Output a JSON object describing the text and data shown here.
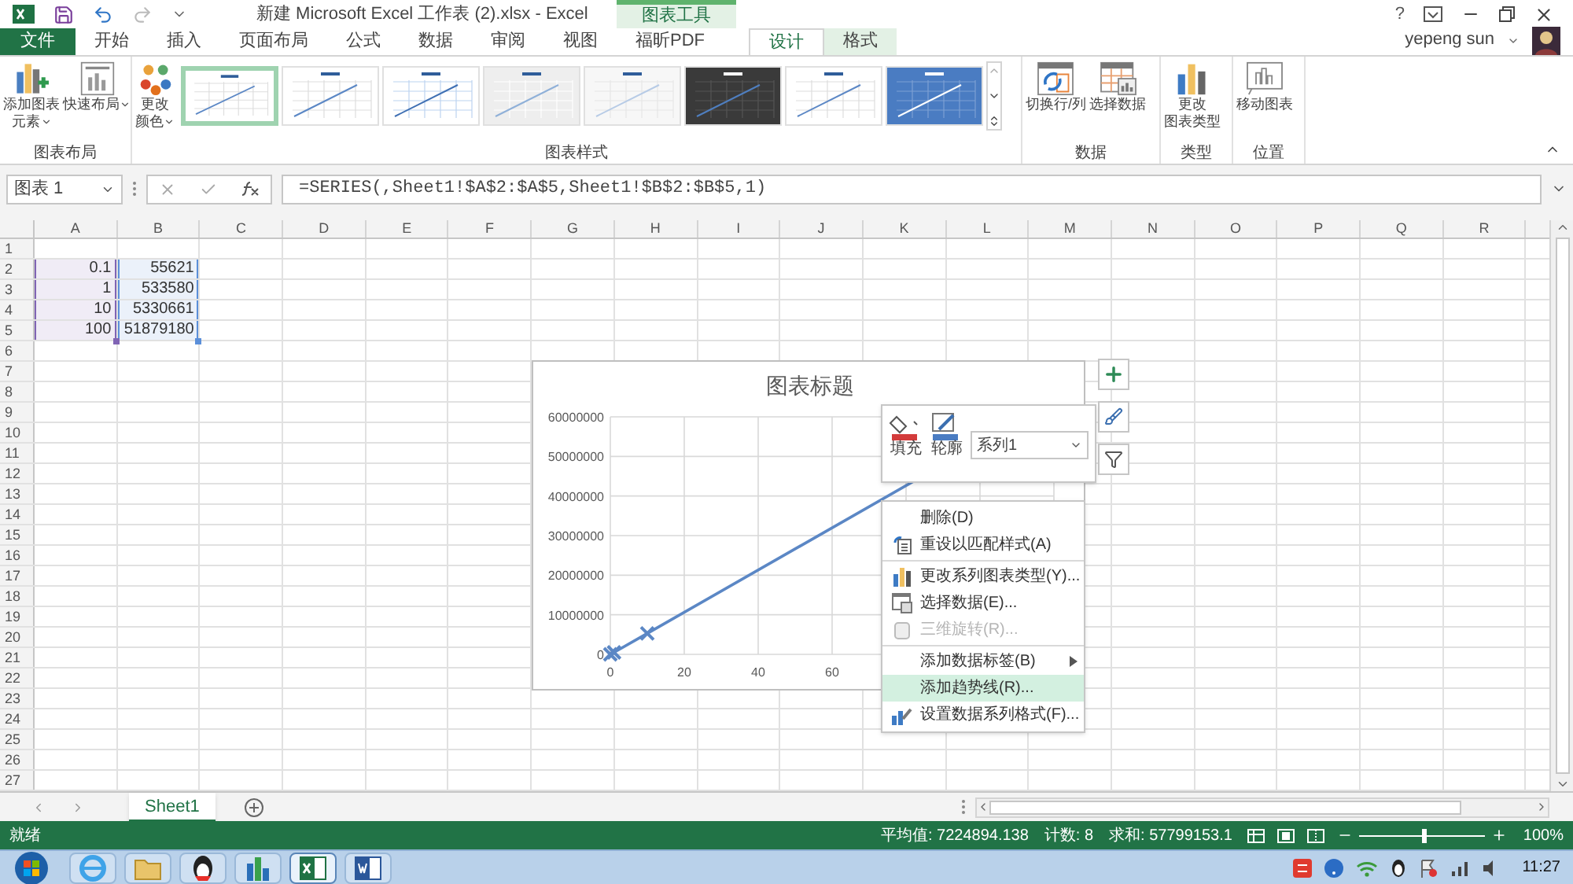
{
  "window": {
    "title": "新建 Microsoft Excel 工作表 (2).xlsx - Excel",
    "help": "?",
    "context_group": "图表工具",
    "user": "yepeng sun"
  },
  "tabs": [
    {
      "label": "文件",
      "kind": "file",
      "selected": false
    },
    {
      "label": "开始",
      "kind": "normal",
      "selected": false
    },
    {
      "label": "插入",
      "kind": "normal",
      "selected": false
    },
    {
      "label": "页面布局",
      "kind": "normal",
      "selected": false
    },
    {
      "label": "公式",
      "kind": "normal",
      "selected": false
    },
    {
      "label": "数据",
      "kind": "normal",
      "selected": false
    },
    {
      "label": "审阅",
      "kind": "normal",
      "selected": false
    },
    {
      "label": "视图",
      "kind": "normal",
      "selected": false
    },
    {
      "label": "福昕PDF",
      "kind": "normal",
      "selected": false
    },
    {
      "label": "设计",
      "kind": "context",
      "selected": true
    },
    {
      "label": "格式",
      "kind": "context",
      "selected": false
    }
  ],
  "ribbon": {
    "groups": [
      {
        "label": "图表布局",
        "buttons": [
          {
            "lines": [
              "添加图表",
              "元素"
            ],
            "dropdown": true
          },
          {
            "lines": [
              "快速布局"
            ],
            "dropdown": true
          }
        ]
      },
      {
        "label": "图表样式",
        "buttons": [
          {
            "lines": [
              "更改",
              "颜色"
            ],
            "dropdown": true
          }
        ],
        "styles": [
          {
            "selected": true
          },
          {
            "selected": false
          },
          {
            "selected": false
          },
          {
            "selected": false
          },
          {
            "selected": false
          },
          {
            "selected": false
          },
          {
            "selected": false
          },
          {
            "selected": false
          }
        ]
      },
      {
        "label": "数据",
        "buttons": [
          {
            "lines": [
              "切换行/列"
            ],
            "dropdown": false
          },
          {
            "lines": [
              "选择数据"
            ],
            "dropdown": false
          }
        ]
      },
      {
        "label": "类型",
        "buttons": [
          {
            "lines": [
              "更改",
              "图表类型"
            ],
            "dropdown": false
          }
        ]
      },
      {
        "label": "位置",
        "buttons": [
          {
            "lines": [
              "移动图表"
            ],
            "dropdown": false
          }
        ]
      }
    ]
  },
  "formula_bar": {
    "name_box": "图表 1",
    "formula": "=SERIES(,Sheet1!$A$2:$A$5,Sheet1!$B$2:$B$5,1)"
  },
  "sheet": {
    "columns": [
      "A",
      "B",
      "C",
      "D",
      "E",
      "F",
      "G",
      "H",
      "I",
      "J",
      "K",
      "L",
      "M",
      "N",
      "O",
      "P",
      "Q",
      "R"
    ],
    "ranges": [
      {
        "color": "#8064b4"
      },
      {
        "color": "#5b8fd9"
      }
    ],
    "rows": [
      {
        "number": "1"
      },
      {
        "number": "2",
        "cells": [
          "0.1",
          "55621"
        ]
      },
      {
        "number": "3",
        "cells": [
          "1",
          "533580"
        ]
      },
      {
        "number": "4",
        "cells": [
          "10",
          "5330661"
        ]
      },
      {
        "number": "5",
        "cells": [
          "100",
          "51879180"
        ]
      },
      {
        "number": "6"
      },
      {
        "number": "7"
      },
      {
        "number": "8"
      },
      {
        "number": "9"
      },
      {
        "number": "10"
      },
      {
        "number": "11"
      },
      {
        "number": "12"
      },
      {
        "number": "13"
      },
      {
        "number": "14"
      },
      {
        "number": "15"
      },
      {
        "number": "16"
      },
      {
        "number": "17"
      },
      {
        "number": "18"
      },
      {
        "number": "19"
      },
      {
        "number": "20"
      },
      {
        "number": "21"
      },
      {
        "number": "22"
      },
      {
        "number": "23"
      },
      {
        "number": "24"
      },
      {
        "number": "25"
      },
      {
        "number": "26"
      },
      {
        "number": "27"
      }
    ]
  },
  "chart": {
    "chart_data": {
      "type": "scatter",
      "title": "图表标题",
      "x": [
        0,
        1,
        10
      ],
      "grid": true,
      "series": [
        {
          "color": "#5b87c5",
          "values": [
            0,
            500000,
            5300000
          ]
        }
      ],
      "xlim": [
        0,
        120
      ],
      "ylim": [
        0,
        60000000
      ],
      "xticks": [
        0,
        20,
        40,
        60
      ],
      "yticks": [
        0,
        10000000,
        20000000,
        30000000,
        40000000,
        50000000,
        60000000
      ]
    }
  },
  "mini_toolbar": {
    "fill": "填充",
    "outline": "轮廓",
    "series": "系列1"
  },
  "context_menu": [
    {
      "label": "删除(D)",
      "disabled": false,
      "highlighted": false,
      "submenu": false,
      "separator_before": false
    },
    {
      "label": "重设以匹配样式(A)",
      "disabled": false,
      "highlighted": false,
      "submenu": false,
      "separator_before": false
    },
    {
      "label": "更改系列图表类型(Y)...",
      "disabled": false,
      "highlighted": false,
      "submenu": false,
      "separator_before": true
    },
    {
      "label": "选择数据(E)...",
      "disabled": false,
      "highlighted": false,
      "submenu": false,
      "separator_before": false
    },
    {
      "label": "三维旋转(R)...",
      "disabled": true,
      "highlighted": false,
      "submenu": false,
      "separator_before": false
    },
    {
      "label": "添加数据标签(B)",
      "disabled": false,
      "highlighted": false,
      "submenu": true,
      "separator_before": true
    },
    {
      "label": "添加趋势线(R)...",
      "disabled": false,
      "highlighted": true,
      "submenu": false,
      "separator_before": false
    },
    {
      "label": "设置数据系列格式(F)...",
      "disabled": false,
      "highlighted": false,
      "submenu": false,
      "separator_before": false
    }
  ],
  "sheet_tabs": [
    {
      "label": "Sheet1",
      "selected": true
    }
  ],
  "status_bar": {
    "ready": "就绪",
    "average": "平均值: 7224894.138",
    "count": "计数: 8",
    "sum": "求和: 57799153.1",
    "zoom_slider": {
      "level": 0.5
    },
    "zoom": "100%"
  },
  "taskbar": {
    "apps": [
      {
        "active": false
      },
      {
        "active": false
      },
      {
        "active": false
      },
      {
        "active": false
      },
      {
        "active": true
      },
      {
        "active": false
      }
    ],
    "time": "11:27"
  }
}
